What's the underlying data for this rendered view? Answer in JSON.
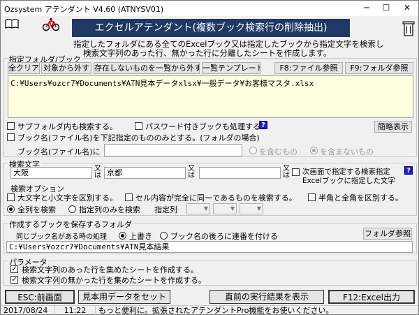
{
  "window": {
    "title": "Ozsystem アテンダント V4.60 (ATNYSV01)",
    "min": "─",
    "max": "☐",
    "close": "✕"
  },
  "header": {
    "banner": "エクセルアテンダント(複数ブック検索行の削除抽出)",
    "desc_line1": "指定したフォルダにある全てのExcelブック又は指定したブックから指定文字を検索し",
    "desc_line2": "検索文字列のあった行、無かった行に分離したシートを作成します。",
    "accent_color": "#1f3864"
  },
  "folder_group": {
    "title": "指定フォルダ/ブック",
    "buttons": {
      "clear_all": "全クリア",
      "exclude": "対象から外す",
      "remove_missing": "存在しないものを一覧から外す",
      "template": "一覧テンプレート",
      "f8": "F8:ファイル参照",
      "f9": "F9:フォルダ参照"
    },
    "list_item": "C:¥Users¥ozcr7¥Documents¥ATN見本データxlsx¥一般データ¥お客様マスタ.xlsx",
    "opt_subfolder": "サブフォルダ内も検索する。",
    "opt_password": "パスワード付きブックも処理する",
    "opt_bookname": "ブック名(ファイル名)を下記指定のもののみとする。(フォルダの場合)",
    "compact_button": "簡略表示",
    "bookname_label": "ブック名(ファイル名)に",
    "bookname_value": "",
    "radio_include": "を含むもの",
    "radio_exclude": "を含まないもの"
  },
  "search_group": {
    "title": "検索文字",
    "term1": "大阪",
    "term2": "京都",
    "term3": "",
    "or_label": "又は",
    "next_screen_line1": "次画面で指定する検索指定",
    "next_screen_line2": "Excelブックに指定した文字",
    "options_title": "検索オプション",
    "opt_case": "大文字と小文字を区別する。",
    "opt_exact": "セル内容が完全に同一であるものを検索する。",
    "opt_width": "半角と全角を区別する。",
    "radio_all_cols": "全列を検索",
    "radio_spec_cols": "指定列のみを検索",
    "spec_col_label": "指定列"
  },
  "save_group": {
    "title": "作成するブックを保存するフォルダ",
    "same_name_label": "同じブック名がある時の処理",
    "radio_overwrite": "上書き",
    "radio_sequence": "ブック名の後ろに連番を付ける",
    "folder_ref": "フォルダ参照",
    "path": "C:¥Users¥ozcr7¥Documents¥ATN見本結果"
  },
  "param_group": {
    "title": "パラメータ",
    "opt_found": "検索文字列のあった行を集めたシートを作成する。",
    "opt_notfound": "検索文字列の無かった行を集めたシートを作成する。"
  },
  "footer": {
    "esc": "ESC:前画面",
    "sample": "見本用データをセット",
    "prev_result": "直前の実行結果を表示",
    "f12": "F12:Excel出力"
  },
  "statusbar": {
    "date": "2017/08/24",
    "time": "11:22",
    "message": "もっと便利に。拡張されたアテンダントPro機能をお使いください。"
  }
}
